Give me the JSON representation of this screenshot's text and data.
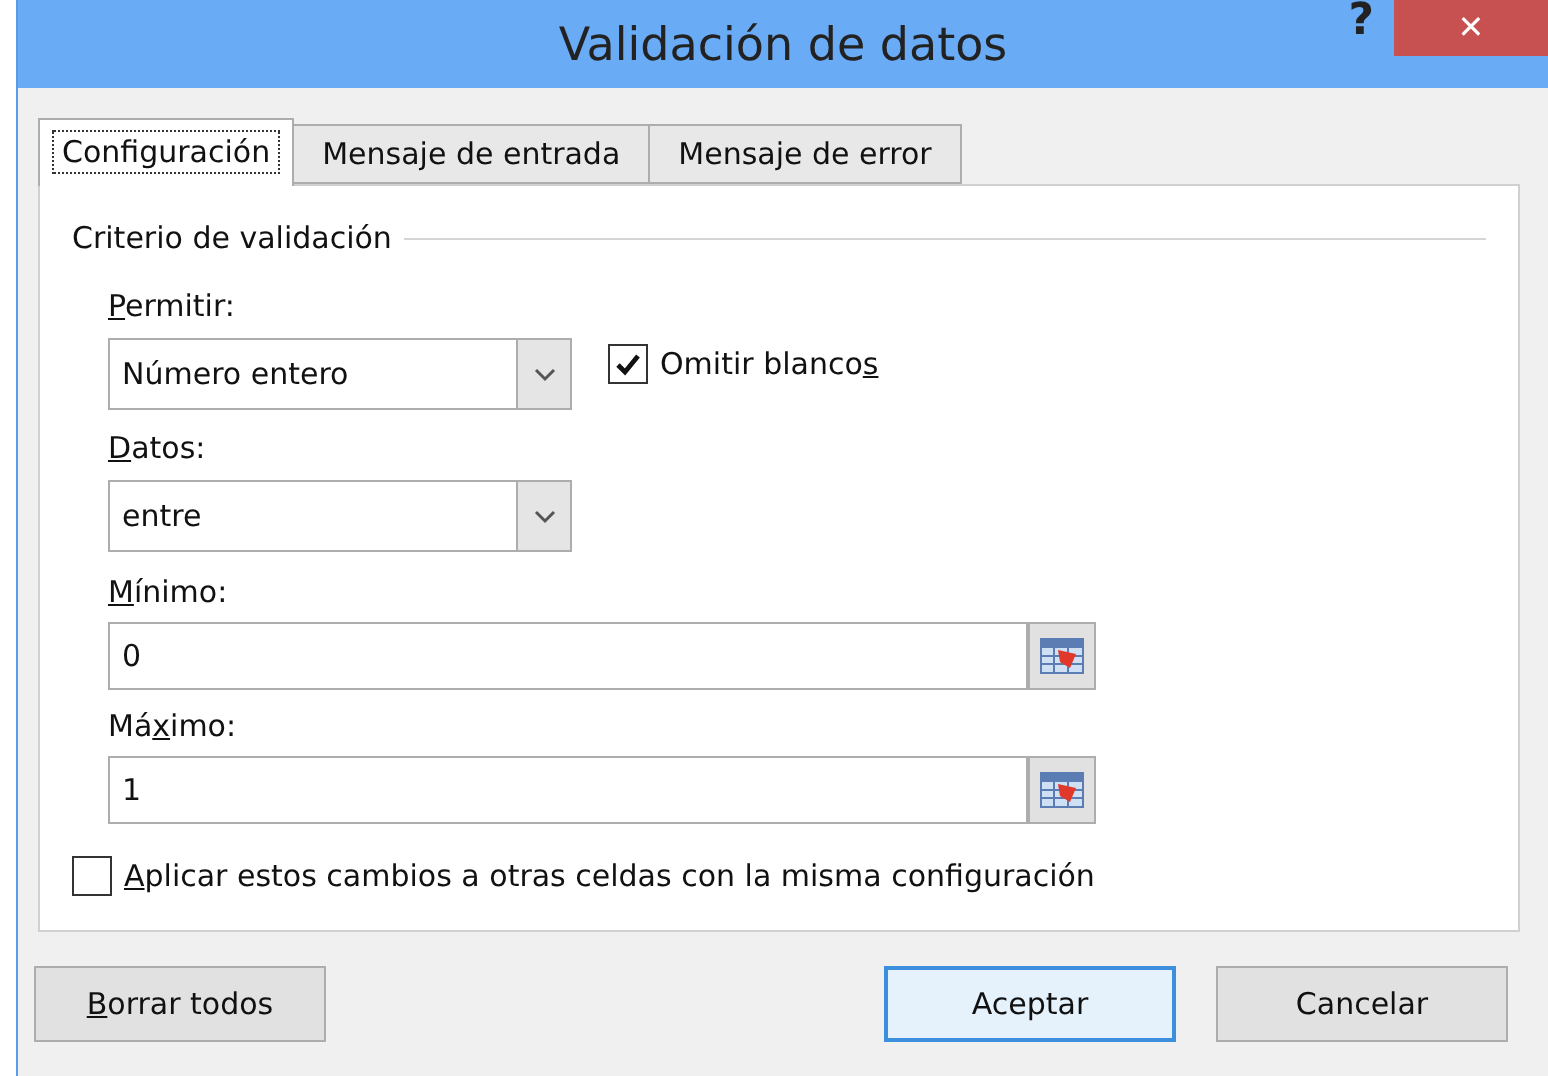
{
  "window": {
    "title": "Validación de datos",
    "help": "?",
    "close": "✕"
  },
  "tabs": [
    {
      "label": "Configuración",
      "selected": true
    },
    {
      "label": "Mensaje de entrada",
      "selected": false
    },
    {
      "label": "Mensaje de error",
      "selected": false
    }
  ],
  "group_title": "Criterio de validación",
  "allow": {
    "label": {
      "key": "P",
      "post": "ermitir:"
    },
    "value": "Número entero"
  },
  "ignore_blank": {
    "label": {
      "pre": "Omitir blanco",
      "key": "s"
    },
    "checked": true
  },
  "data": {
    "label": {
      "key": "D",
      "post": "atos:"
    },
    "value": "entre"
  },
  "minimum": {
    "label": {
      "key": "M",
      "post": "ínimo:"
    },
    "value": "0"
  },
  "maximum": {
    "label": {
      "pre": "Má",
      "key": "x",
      "post": "imo:"
    },
    "value": "1"
  },
  "apply_all": {
    "label": {
      "key": "A",
      "post": "plicar estos cambios a otras celdas con la misma configuración"
    },
    "checked": false
  },
  "buttons": {
    "clear": {
      "key": "B",
      "post": "orrar todos"
    },
    "ok": "Aceptar",
    "cancel": "Cancelar"
  }
}
